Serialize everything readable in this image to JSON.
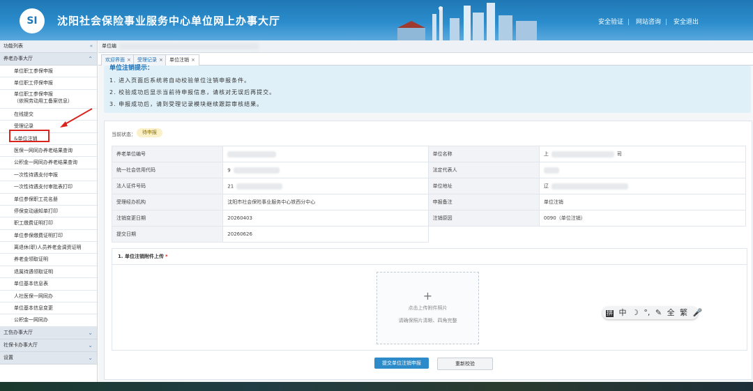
{
  "header": {
    "logo": "SI",
    "title": "沈阳社会保险事业服务中心单位网上办事大厅",
    "links": [
      "安全验证",
      "网站咨询",
      "安全退出"
    ]
  },
  "sidebar": {
    "header": "功能列表",
    "groups_top": "养老办事大厅",
    "items": [
      "单位职工参保申报",
      "单位职工停保申报",
      "单位职工参保申报",
      "（依照劳动用工备案信息）",
      "在线提交",
      "受理记录",
      "&单位注销",
      "医保一网同办养老结果查询",
      "公积金一网同办养老结果查询",
      "一次性待遇支付申报",
      "一次性待遇支付审批表打印",
      "单位参保职工花名册",
      "停保变动通知单打印",
      "职工缴费证明打印",
      "单位参保缴费证明打印",
      "离退休(职)人员养老金调资证明",
      "养老金领取证明",
      "退属待遇领取证明",
      "单位基本信息表",
      "人社医保一网同办",
      "单位基本信息变更",
      "公积金一网同办"
    ],
    "groups_bottom": [
      "工伤办事大厅",
      "社保卡办事大厅",
      "设置"
    ]
  },
  "crumb": {
    "label": "单位编"
  },
  "tabs": [
    {
      "label": "欢迎界面",
      "close": "×"
    },
    {
      "label": "受理记录",
      "close": "×"
    },
    {
      "label": "单位注销",
      "close": "×"
    }
  ],
  "notice": {
    "title": "单位注销提示：",
    "lines": [
      "1. 进入页面后系统将自动校验单位注销申报条件。",
      "2. 校验成功后显示当前待申报信息，请核对无误后再提交。",
      "3. 申报成功后，请到受理记录模块继续跟踪审核结果。"
    ]
  },
  "status": {
    "label": "当前状态：",
    "value": "待申报"
  },
  "info": {
    "rows": [
      {
        "l1": "养老单位编号",
        "v1": "",
        "l2": "单位名称",
        "v2": "上"
      },
      {
        "l1": "统一社会信用代码",
        "v1": "9",
        "l2": "法定代表人",
        "v2": ""
      },
      {
        "l1": "法人证件号码",
        "v1": "21",
        "l2": "单位地址",
        "v2": "辽"
      },
      {
        "l1": "受理经办机构",
        "v1": "沈阳市社会保险事业服务中心铁西分中心",
        "l2": "申报备注",
        "v2": "单位注销"
      },
      {
        "l1": "注销变更日期",
        "v1": "20260403",
        "l2": "注销原因",
        "v2": "0090（单位注销）"
      },
      {
        "l1": "提交日期",
        "v1": "20260626",
        "l2": "",
        "v2": ""
      }
    ],
    "name_suffix": "司"
  },
  "upload": {
    "title": "1. 单位注销附件上传",
    "required_mark": "*",
    "plus": "+",
    "hint1": "点击上传附件照片",
    "hint2": "请确保照片清晰、四角完整"
  },
  "buttons": {
    "submit": "提交单位注销申报",
    "reset": "重新校验"
  },
  "ime": {
    "items": [
      "拼",
      "中",
      "☽",
      "°,",
      "✎",
      "全",
      "繁",
      "🎤"
    ]
  },
  "colors": {
    "header": "#2b8ccc",
    "accent": "#2d8bc9",
    "highlight": "#d9231c"
  }
}
